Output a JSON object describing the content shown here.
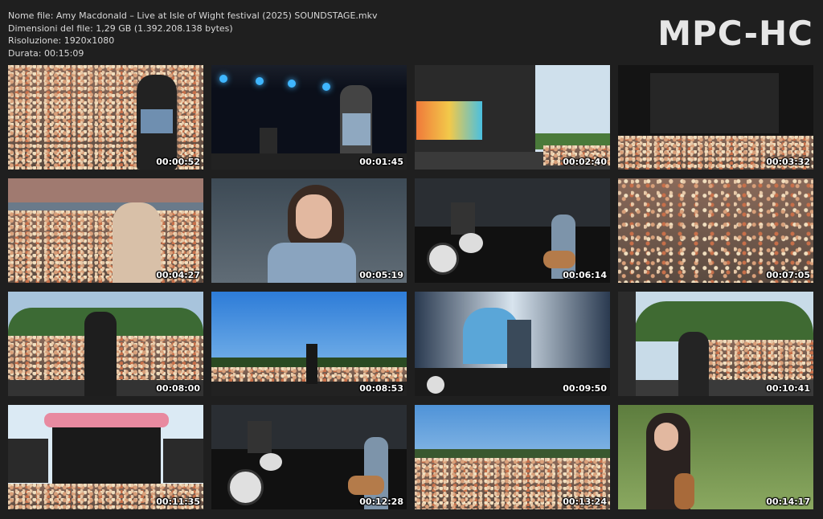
{
  "info": {
    "filename": "Nome file: Amy Macdonald – Live at Isle of Wight festival (2025) SOUNDSTAGE.mkv",
    "filesize": "Dimensioni del file: 1,29 GB (1.392.208.138 bytes)",
    "resolution": "Risoluzione: 1920x1080",
    "duration": "Durata: 00:15:09"
  },
  "logo": "MPC-HC",
  "thumbnails": [
    {
      "time": "00:00:52"
    },
    {
      "time": "00:01:45"
    },
    {
      "time": "00:02:40"
    },
    {
      "time": "00:03:32"
    },
    {
      "time": "00:04:27"
    },
    {
      "time": "00:05:19"
    },
    {
      "time": "00:06:14"
    },
    {
      "time": "00:07:05"
    },
    {
      "time": "00:08:00"
    },
    {
      "time": "00:08:53"
    },
    {
      "time": "00:09:50"
    },
    {
      "time": "00:10:41"
    },
    {
      "time": "00:11:35"
    },
    {
      "time": "00:12:28"
    },
    {
      "time": "00:13:24"
    },
    {
      "time": "00:14:17"
    }
  ]
}
